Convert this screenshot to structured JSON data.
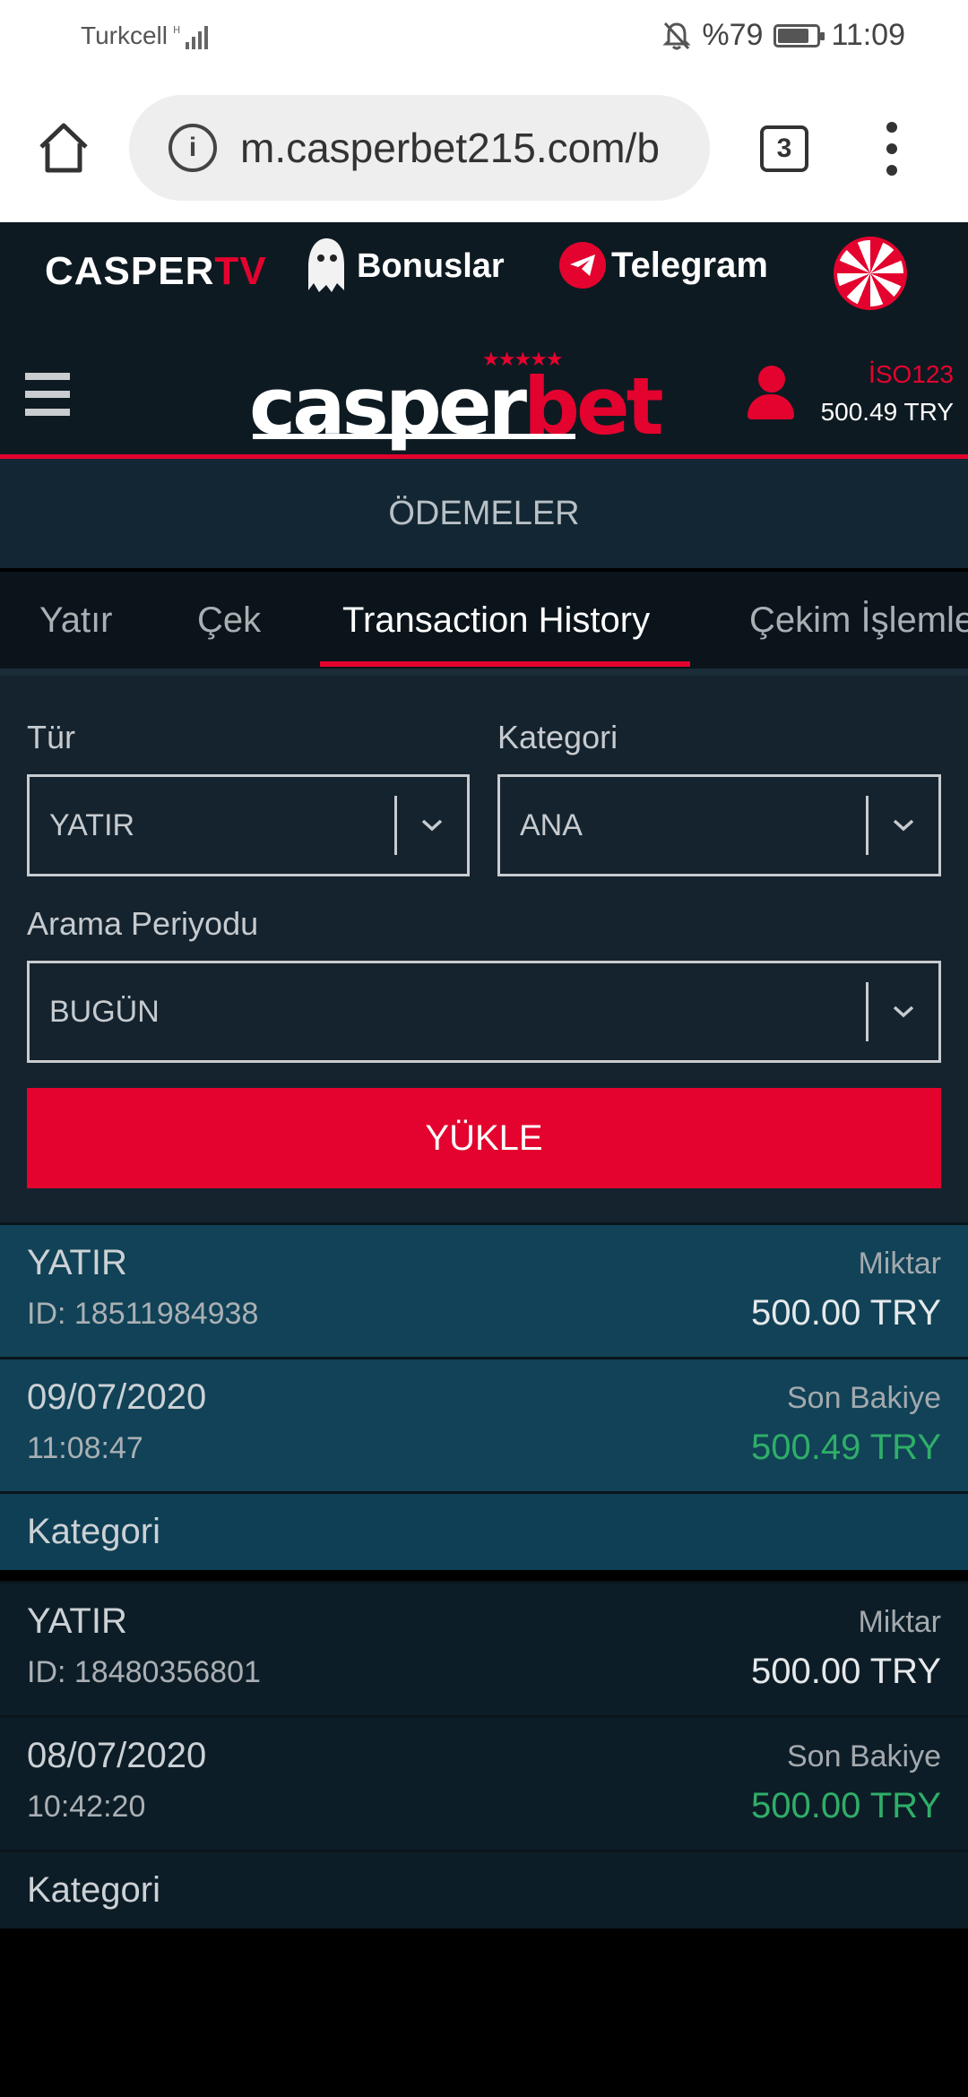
{
  "status_bar": {
    "carrier": "Turkcell",
    "battery": "%79",
    "battery_level": 0.79,
    "time": "11:09"
  },
  "browser": {
    "url": "m.casperbet215.com/b",
    "tab_count": "3"
  },
  "promo": {
    "tv_main": "CASPER",
    "tv_accent": "TV",
    "bonus": "Bonuslar",
    "telegram": "Telegram"
  },
  "header": {
    "logo_main": "casper",
    "logo_accent": "bet",
    "username": "İSO123",
    "balance": "500.49 TRY"
  },
  "page_title": "ÖDEMELER",
  "tabs": [
    {
      "label": "Yatır"
    },
    {
      "label": "Çek"
    },
    {
      "label": "Transaction History"
    },
    {
      "label": "Çekim İşlemleri"
    }
  ],
  "filters": {
    "type_label": "Tür",
    "type_value": "YATIR",
    "category_label": "Kategori",
    "category_value": "ANA",
    "period_label": "Arama Periyodu",
    "period_value": "BUGÜN",
    "load_button": "YÜKLE"
  },
  "transactions": [
    {
      "type": "YATIR",
      "id": "ID: 18511984938",
      "amount_label": "Miktar",
      "amount": "500.00 TRY",
      "date": "09/07/2020",
      "time": "11:08:47",
      "balance_label": "Son Bakiye",
      "balance": "500.49 TRY",
      "category_label": "Kategori"
    },
    {
      "type": "YATIR",
      "id": "ID: 18480356801",
      "amount_label": "Miktar",
      "amount": "500.00 TRY",
      "date": "08/07/2020",
      "time": "10:42:20",
      "balance_label": "Son Bakiye",
      "balance": "500.00 TRY",
      "category_label": "Kategori"
    }
  ],
  "colors": {
    "accent": "#e4032e",
    "positive": "#2fae68",
    "bg_dark": "#0e1a22"
  }
}
